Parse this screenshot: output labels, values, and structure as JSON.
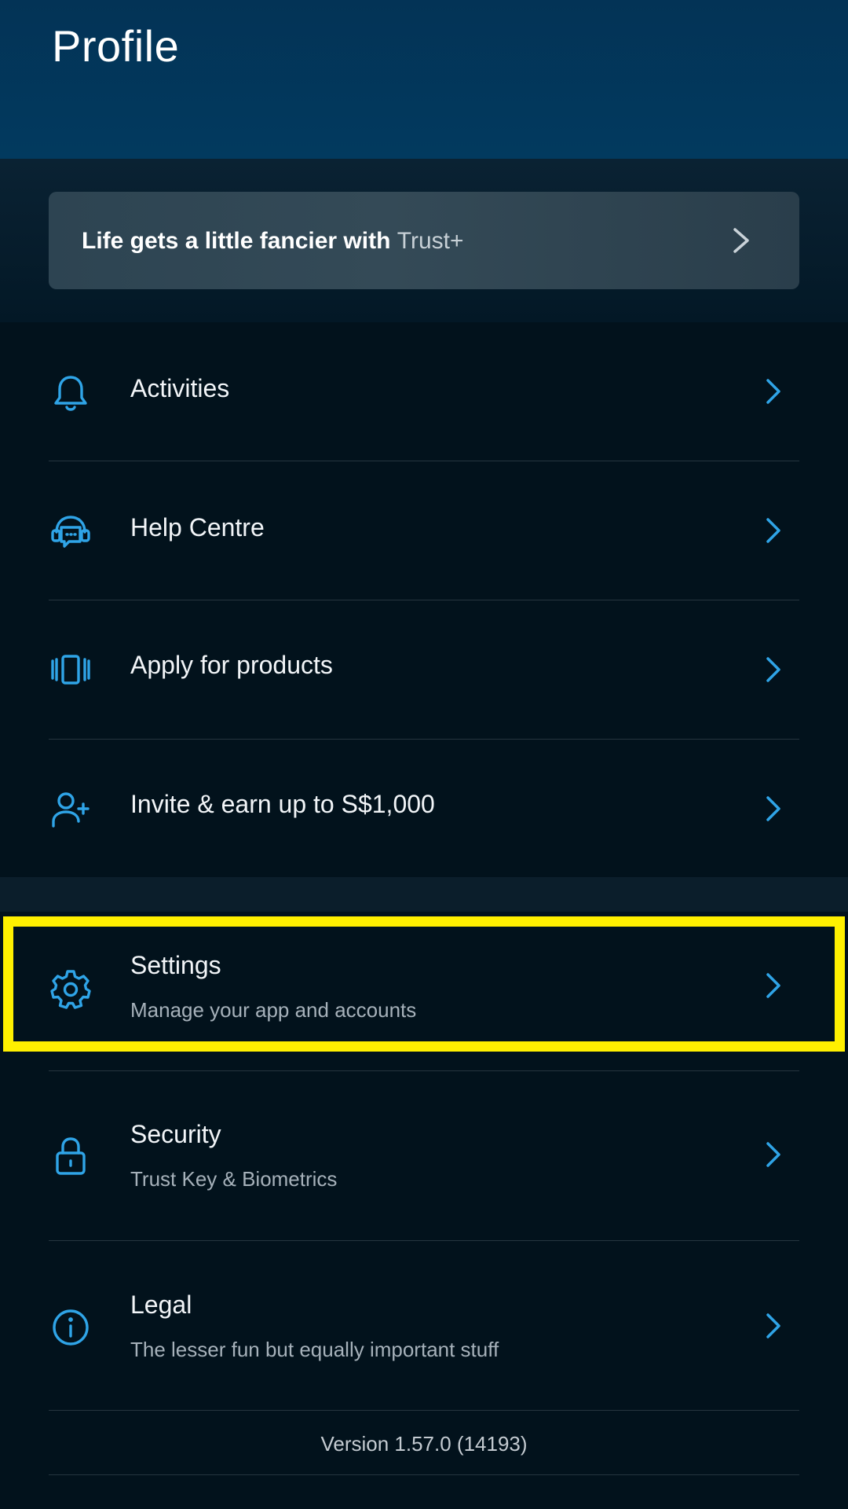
{
  "header": {
    "title": "Profile"
  },
  "promo": {
    "text": "Life gets a little fancier with ",
    "brand": "Trust+"
  },
  "menu": [
    {
      "label": "Activities",
      "icon": "bell-icon"
    },
    {
      "label": "Help Centre",
      "icon": "headset-chat-icon"
    },
    {
      "label": "Apply for products",
      "icon": "cards-icon"
    },
    {
      "label": "Invite & earn up to S$1,000",
      "icon": "add-user-icon"
    }
  ],
  "settings_menu": [
    {
      "label": "Settings",
      "subtitle": "Manage your app and accounts",
      "icon": "gear-icon"
    },
    {
      "label": "Security",
      "subtitle": "Trust Key & Biometrics",
      "icon": "lock-icon"
    },
    {
      "label": "Legal",
      "subtitle": "The lesser fun but equally important stuff",
      "icon": "info-icon"
    }
  ],
  "footer": {
    "version": "Version 1.57.0 (14193)"
  },
  "colors": {
    "accent": "#2fa4e7",
    "highlight": "#fff000",
    "header_bg": "#023a5f"
  }
}
